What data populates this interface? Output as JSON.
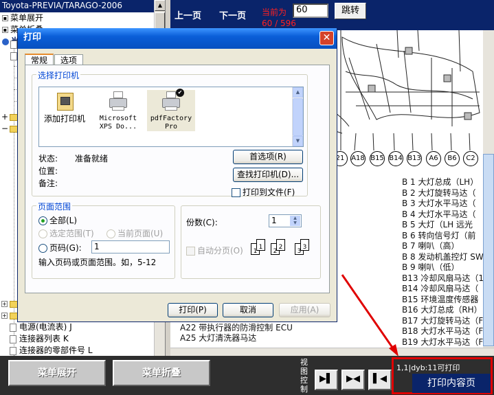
{
  "tree": {
    "title": "Toyota-PREVIA/TARAGO-2006",
    "expand_label": "菜单展开",
    "collapse_label": "菜单折叠",
    "truncated_label": "当",
    "bottom_items": [
      "电源(电流表)",
      "连接器列表",
      "连接器的零部件号"
    ],
    "bottom_suffixes": [
      "J",
      "K",
      "L"
    ]
  },
  "toolbar": {
    "prev_label": "上一页",
    "next_label": "下一页",
    "current_label": "当前为",
    "page_value": "60",
    "page_count": "60 / 596",
    "jump_label": "跳转"
  },
  "diagram": {
    "connectors": [
      "21",
      "A18",
      "B15",
      "B14",
      "B13",
      "A6",
      "B6",
      "C2"
    ],
    "legend": [
      "B 1 大灯总成（LH）",
      "B 2 大灯旋转马达（",
      "B 3 大灯水平马达（",
      "B 4 大灯水平马达（",
      "B 5 大灯（LH 远光",
      "B 6 转向信号灯（前",
      "B 7 喇叭（高）",
      "B 8 发动机盖控灯 SW",
      "B 9 喇叭（低）",
      "B13 冷却风扇马达（1",
      "B14 冷却风扇马达（",
      "B15 环境温度传感器",
      "B16 大灯总成（RH）",
      "B17 大灯旋转马达（F",
      "B18 大灯水平马达（F",
      "B19 大灯水平马达（F"
    ],
    "notes": [
      "A22 带执行器的防滑控制 ECU",
      "A25 大灯清洗器马达"
    ]
  },
  "bottom": {
    "expand_button": "菜单展开",
    "collapse_button": "菜单折叠",
    "view_ctrl": [
      "视",
      "图",
      "控",
      "制"
    ],
    "status": "1,1|dyb:11可打印",
    "print_content_button": "打印内容页"
  },
  "dialog": {
    "title": "打印",
    "tabs": [
      "常规",
      "选项"
    ],
    "select_printer_label": "选择打印机",
    "printers": [
      {
        "name": "添加打印机",
        "icon": "add-printer-icon"
      },
      {
        "name": "Microsoft XPS Do...",
        "icon": "printer-icon"
      },
      {
        "name": "pdfFactory Pro",
        "icon": "printer-icon",
        "default": true
      }
    ],
    "status_label": "状态:",
    "status_value": "准备就绪",
    "location_label": "位置:",
    "comment_label": "备注:",
    "preferences_button": "首选项(R)",
    "find_printer_button": "查找打印机(D)...",
    "print_to_file_label": "打印到文件(F)",
    "page_range_label": "页面范围",
    "all_label": "全部(L)",
    "selection_label": "选定范围(T)",
    "current_page_label": "当前页面(U)",
    "pages_label": "页码(G):",
    "pages_value": "1",
    "hint": "输入页码或页面范围。如，5-12",
    "copies_label": "份数(C):",
    "copies_value": "1",
    "collate_label": "自动分页(O)",
    "print_button": "打印(P)",
    "cancel_button": "取消",
    "apply_button": "应用(A)"
  }
}
